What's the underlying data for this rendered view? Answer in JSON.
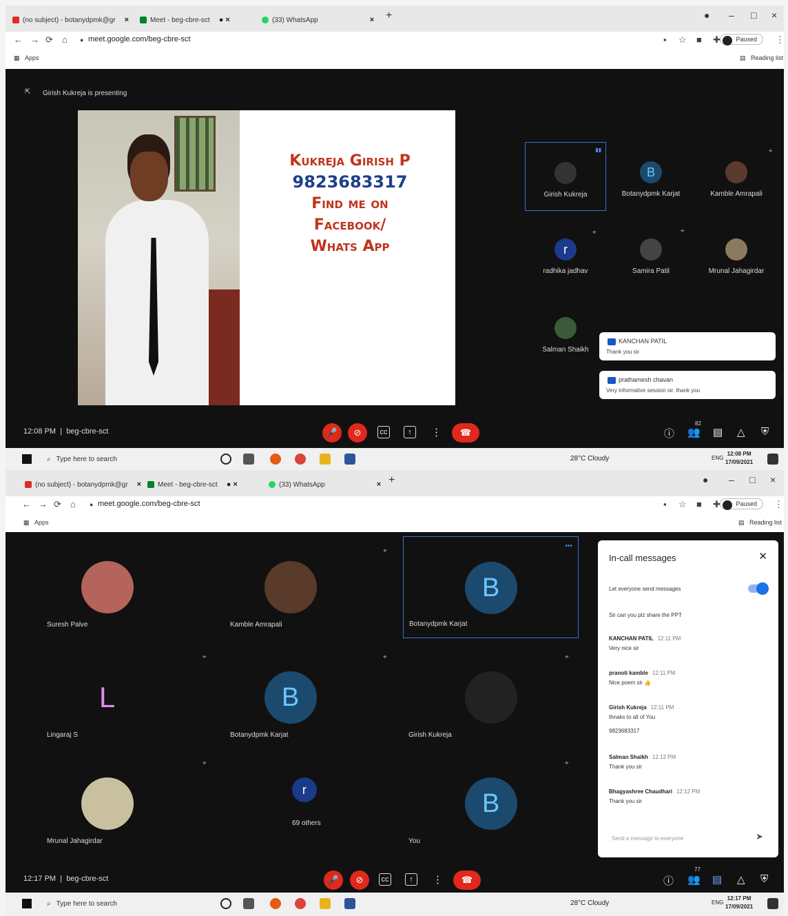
{
  "shot1": {
    "tabs": [
      {
        "label": "(no subject) - botanydpmk@gr",
        "color": "#d93025"
      },
      {
        "label": "Meet - beg-cbre-sct",
        "color": "#00832d"
      },
      {
        "label": "(33) WhatsApp",
        "color": "#25d366"
      }
    ],
    "url": "meet.google.com/beg-cbre-sct",
    "paused": "Paused",
    "apps": "Apps",
    "reading_list": "Reading list",
    "presenting": "Girish Kukreja is presenting",
    "slide": {
      "name": "Kukreja Girish P",
      "phone": "9823683317",
      "line1": "Find me on",
      "line2": "Facebook/",
      "line3": "Whats App"
    },
    "tiles": [
      {
        "name": "Girish Kukreja",
        "initial": "",
        "color": "#333333"
      },
      {
        "name": "Botanydpmk Karjat",
        "initial": "B",
        "color": "#1c4a6e"
      },
      {
        "name": "Kamble Amrapali",
        "initial": "",
        "color": "#5a3a2a"
      },
      {
        "name": "radhika jadhav",
        "initial": "r",
        "color": "#1a3a8a"
      },
      {
        "name": "Samira Patil",
        "initial": "",
        "color": "#444444"
      },
      {
        "name": "Mrunal Jahagirdar",
        "initial": "",
        "color": "#8a7a60"
      },
      {
        "name": "Salman Shaikh",
        "initial": "",
        "color": "#3a5a3a"
      }
    ],
    "notifications": [
      {
        "sender": "KANCHAN PATIL",
        "text": "Thank you sir"
      },
      {
        "sender": "prathamesh chavan",
        "text": "Very informative session sir. thank you"
      }
    ],
    "time": "12:08 PM",
    "meeting_code": "beg-cbre-sct",
    "people_count": "82",
    "taskbar": {
      "search": "Type here to search",
      "weather": "28°C Cloudy",
      "lang": "ENG",
      "clock_time": "12:08 PM",
      "clock_date": "17/09/2021"
    }
  },
  "shot2": {
    "tabs": [
      {
        "label": "(no subject) - botanydpmk@gr",
        "color": "#d93025"
      },
      {
        "label": "Meet - beg-cbre-sct",
        "color": "#00832d"
      },
      {
        "label": "(33) WhatsApp",
        "color": "#25d366"
      }
    ],
    "url": "meet.google.com/beg-cbre-sct",
    "paused": "Paused",
    "apps": "Apps",
    "reading_list": "Reading list",
    "grid": [
      {
        "name": "Suresh Palve",
        "initial": "",
        "color": "#b4645a"
      },
      {
        "name": "Kamble Amrapali",
        "initial": "",
        "color": "#5a3a2a"
      },
      {
        "name": "Botanydpmk Karjat",
        "initial": "B",
        "color": "#1c4a6e"
      },
      {
        "name": "Lingaraj S",
        "initial": "L",
        "color": "#111111"
      },
      {
        "name": "Botanydpmk Karjat",
        "initial": "B",
        "color": "#1c4a6e"
      },
      {
        "name": "Girish Kukreja",
        "initial": "",
        "color": "#222222"
      },
      {
        "name": "Mrunal Jahagirdar",
        "initial": "",
        "color": "#c9c0a0"
      },
      {
        "name": "69 others",
        "initial": "r",
        "color": "#1a3a8a"
      },
      {
        "name": "You",
        "initial": "B",
        "color": "#1c4a6e"
      }
    ],
    "panel": {
      "title": "In-call messages",
      "allow_label": "Let everyone send messages",
      "first_text": "Sir can you plz share the PPT",
      "messages": [
        {
          "sender": "KANCHAN PATIL",
          "time": "12:11 PM",
          "text": "Very nice sir"
        },
        {
          "sender": "pranoti kamble",
          "time": "12:11 PM",
          "text": "Nice poem sir 👍"
        },
        {
          "sender": "Girish Kukreja",
          "time": "12:11 PM",
          "text": "thnaks to all of You",
          "extra": "9823683317"
        },
        {
          "sender": "Salman Shaikh",
          "time": "12:12 PM",
          "text": "Thank you sir"
        },
        {
          "sender": "Bhagyashree Chaudhari",
          "time": "12:12 PM",
          "text": "Thank you sir"
        }
      ],
      "input_placeholder": "Send a message to everyone"
    },
    "time": "12:17 PM",
    "meeting_code": "beg-cbre-sct",
    "people_count": "77",
    "taskbar": {
      "search": "Type here to search",
      "weather": "28°C Cloudy",
      "lang": "ENG",
      "clock_time": "12:17 PM",
      "clock_date": "17/09/2021"
    }
  }
}
